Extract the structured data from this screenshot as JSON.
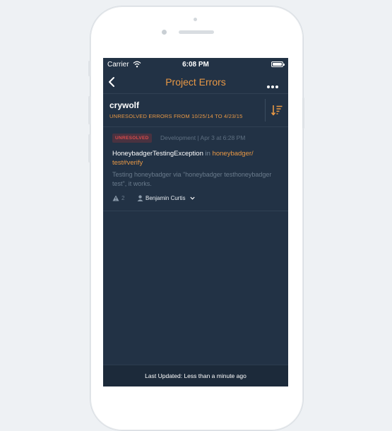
{
  "status_bar": {
    "carrier": "Carrier",
    "time": "6:08 PM",
    "battery_level": 1.0
  },
  "nav": {
    "title": "Project Errors"
  },
  "project": {
    "name": "crywolf",
    "date_range": "UNRESOLVED ERRORS FROM 10/25/14 TO 4/23/15"
  },
  "error": {
    "status_badge": "UNRESOLVED",
    "meta": "Development | Apr 3 at 6:28 PM",
    "exception": "HoneybadgerTestingException",
    "in_word": "in",
    "location_line1": "honeybadger/",
    "location_line2": "test#verify",
    "message": "Testing honeybadger via \"honeybadger testhoneybadger test\", it works.",
    "occurrences": "2",
    "assignee": "Benjamin Curtis"
  },
  "footer": {
    "last_updated": "Last Updated: Less than a minute ago"
  },
  "colors": {
    "accent": "#e89845",
    "background": "#223245",
    "badge_text": "#d94b4b"
  }
}
